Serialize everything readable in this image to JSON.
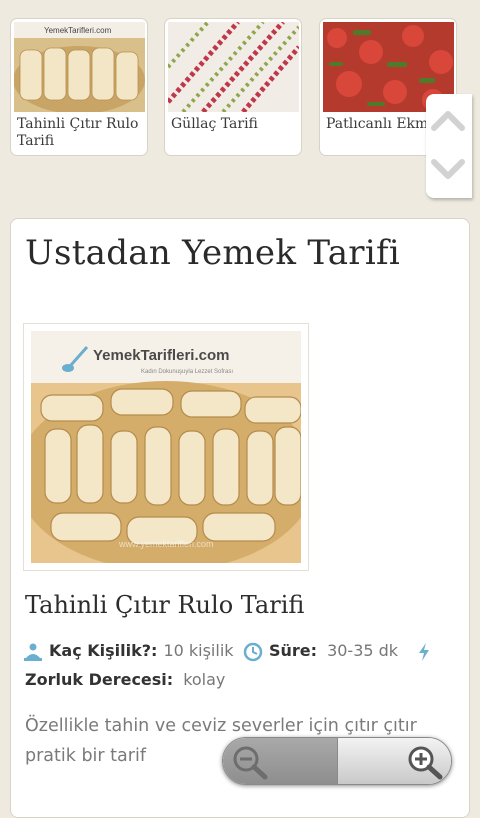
{
  "carousel": {
    "cards": [
      {
        "caption": "Tahinli Çıtır Rulo Tarifi",
        "thumb": "tahinli-rolls-photo"
      },
      {
        "caption": "Güllaç Tarifi",
        "thumb": "gullac-photo"
      },
      {
        "caption": "Patlıcanlı Ekmek Salatası Tarifi",
        "thumb": "eggplant-salad-photo"
      }
    ],
    "arrows": {
      "up_icon": "chevron-up-icon",
      "down_icon": "chevron-down-icon"
    }
  },
  "article": {
    "title": "Ustadan Yemek Tarifi",
    "photo": {
      "logo_text": "YemekTarifleri.com",
      "logo_subtext": "Kadın Dokunuşuyla Lezzet Sofrası",
      "watermark": "www.yemektarifleri.com"
    },
    "recipe_title": "Tahinli Çıtır Rulo Tarifi",
    "servings": {
      "icon": "people-icon",
      "label": "Kaç Kişilik?:",
      "value": "10 kişilik"
    },
    "duration": {
      "icon": "clock-icon",
      "label": "Süre:",
      "value": "30-35 dk"
    },
    "difficulty_icon": "lightning-icon",
    "difficulty": {
      "label": "Zorluk Derecesi:",
      "value": "kolay"
    },
    "intro": "Özellikle tahin ve ceviz severler için çıtır çıtır pratik bir tarif"
  },
  "zoom": {
    "out_icon": "zoom-out-icon",
    "in_icon": "zoom-in-icon"
  },
  "colors": {
    "background": "#eeeadf",
    "accent_blue": "#6aaed0",
    "title_text": "#2a2a2a",
    "muted_text": "#7a7a7a"
  }
}
